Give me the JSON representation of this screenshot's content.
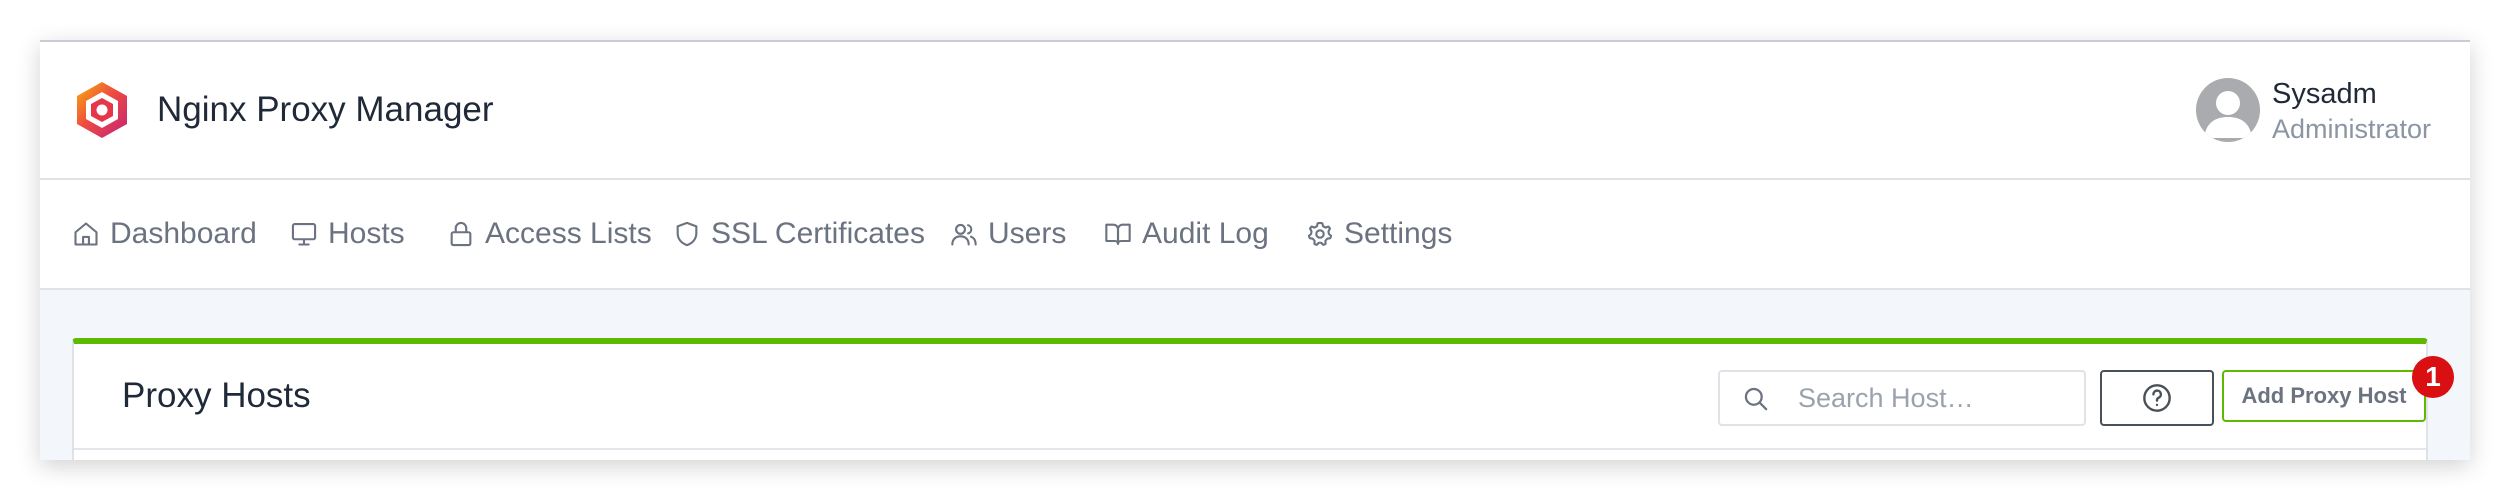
{
  "app": {
    "title": "Nginx Proxy Manager"
  },
  "user": {
    "name": "Sysadm",
    "role": "Administrator"
  },
  "nav": {
    "items": [
      {
        "label": "Dashboard",
        "icon": "home-icon"
      },
      {
        "label": "Hosts",
        "icon": "monitor-icon"
      },
      {
        "label": "Access Lists",
        "icon": "lock-icon"
      },
      {
        "label": "SSL Certificates",
        "icon": "shield-icon"
      },
      {
        "label": "Users",
        "icon": "users-icon"
      },
      {
        "label": "Audit Log",
        "icon": "book-open-icon"
      },
      {
        "label": "Settings",
        "icon": "gear-icon"
      }
    ]
  },
  "page": {
    "title": "Proxy Hosts",
    "search": {
      "placeholder": "Search Host…",
      "value": ""
    },
    "help_icon": "help-circle-icon",
    "add_button_label": "Add Proxy Host",
    "badge_count": "1"
  },
  "colors": {
    "accent_green": "#5eba00",
    "badge_red": "#d90f12"
  }
}
